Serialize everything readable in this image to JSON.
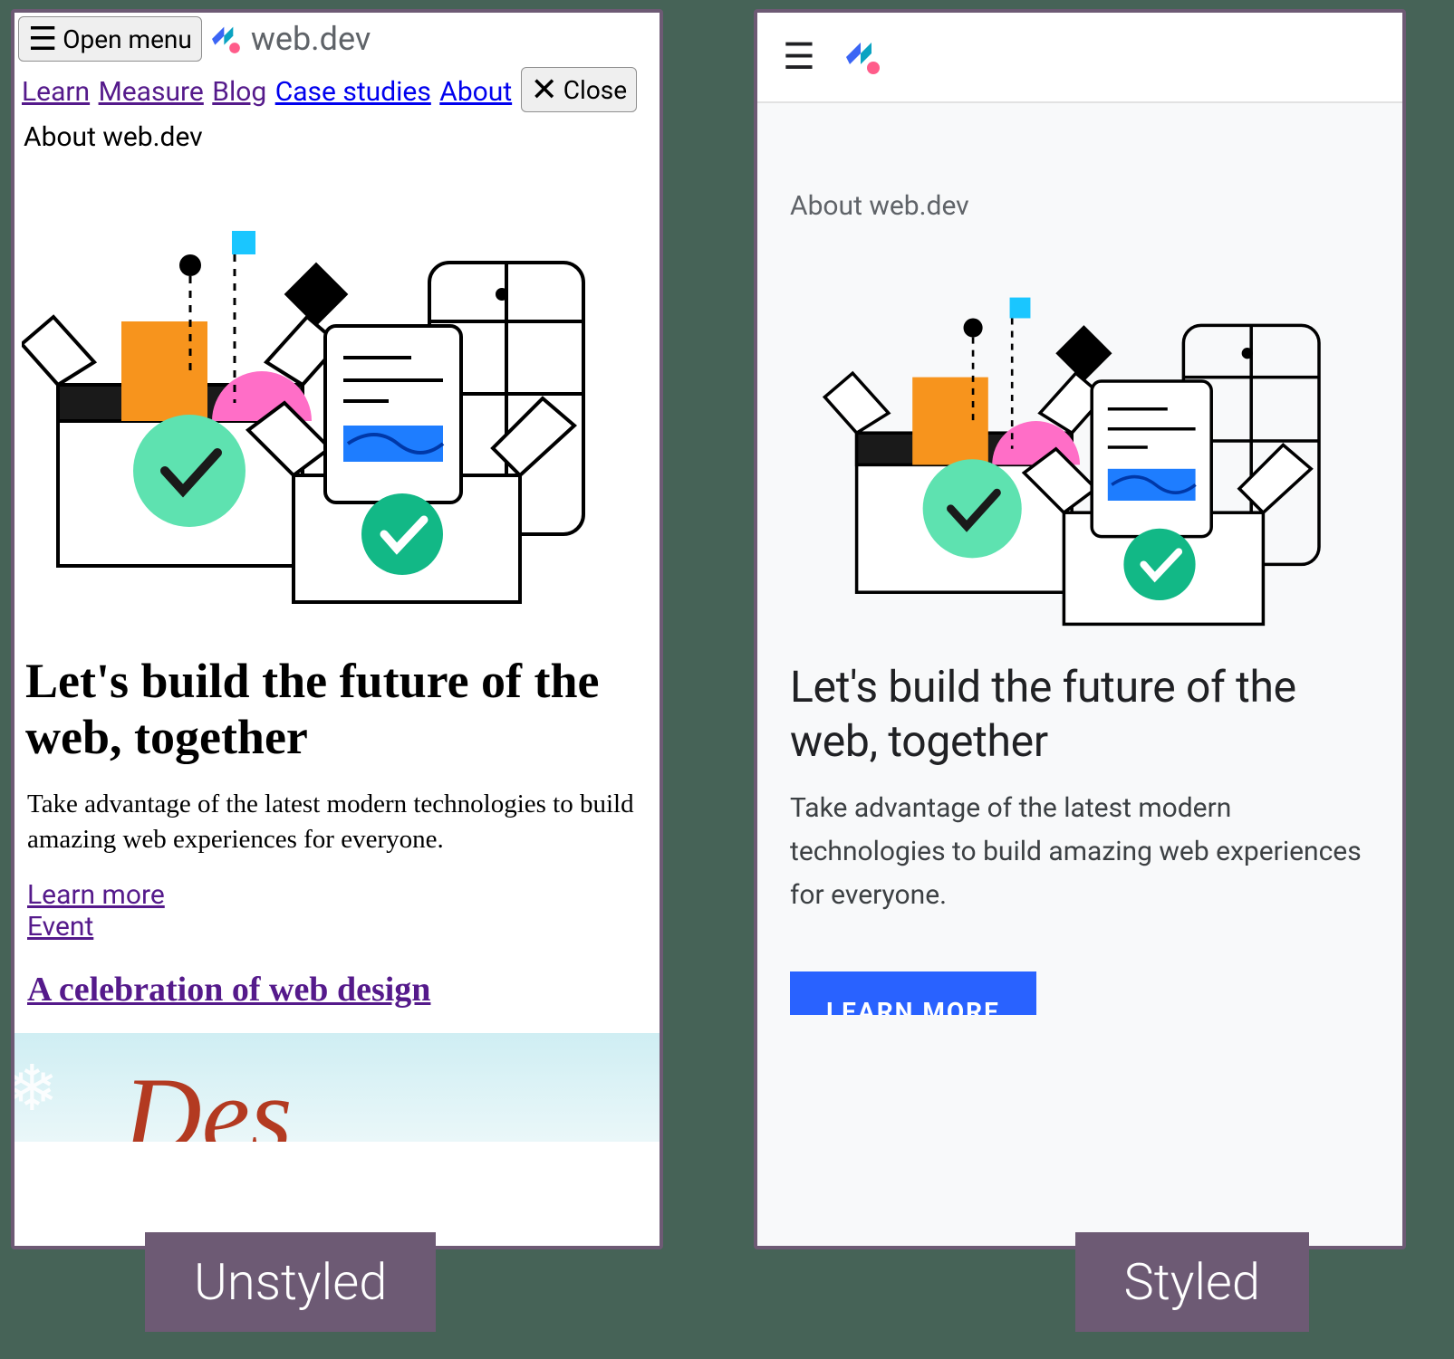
{
  "labels": {
    "left": "Unstyled",
    "right": "Styled"
  },
  "logo": {
    "text": "web.dev"
  },
  "unstyled": {
    "open_menu": "Open menu",
    "close": "Close",
    "nav": {
      "learn": "Learn",
      "measure": "Measure",
      "blog": "Blog",
      "case_studies": "Case studies",
      "about": "About"
    },
    "eyebrow": "About web.dev",
    "h1": "Let's build the future of the web, together",
    "lede": "Take advantage of the latest modern technologies to build amazing web experiences for everyone.",
    "learn_more": "Learn more",
    "event": "Event",
    "h2": "A celebration of web design"
  },
  "styled": {
    "eyebrow": "About web.dev",
    "h1": "Let's build the future of the web, together",
    "lede": "Take advantage of the latest modern technologies to build amazing web experiences for everyone.",
    "cta": "LEARN MORE"
  }
}
